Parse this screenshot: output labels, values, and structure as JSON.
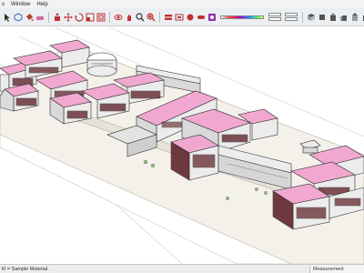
{
  "menu": {
    "items": [
      {
        "label": "s",
        "name": "menu-tools"
      },
      {
        "label": "Window",
        "name": "menu-window"
      },
      {
        "label": "Help",
        "name": "menu-help"
      }
    ]
  },
  "toolbar": {
    "groups_left": [
      {
        "name": "select-icon",
        "color": "#333333"
      },
      {
        "name": "component-icon",
        "color": "#3a66b8"
      },
      {
        "name": "paint-bucket-icon",
        "color": "#b04030"
      },
      {
        "name": "eraser-icon",
        "color": "#d26aa0"
      },
      {
        "name": "sep"
      },
      {
        "name": "pushpull-icon",
        "color": "#c03030"
      },
      {
        "name": "move-icon",
        "color": "#c03030"
      },
      {
        "name": "rotate-icon",
        "color": "#c03030"
      },
      {
        "name": "scale-icon",
        "color": "#c03030"
      },
      {
        "name": "offset-icon",
        "color": "#c03030"
      },
      {
        "name": "sep"
      },
      {
        "name": "orbit-icon",
        "color": "#c03030"
      },
      {
        "name": "pan-icon",
        "color": "#c03030"
      },
      {
        "name": "zoom-icon",
        "color": "#333333"
      },
      {
        "name": "zoom-extents-icon",
        "color": "#c03030"
      },
      {
        "name": "sep"
      },
      {
        "name": "section-icon",
        "color": "#c03030"
      },
      {
        "name": "xray-icon",
        "color": "#c03030"
      },
      {
        "name": "shadow-icon",
        "color": "#c03030"
      },
      {
        "name": "fog-icon",
        "color": "#c03030"
      },
      {
        "name": "style-icon",
        "color": "#9030a0"
      }
    ],
    "groups_right": [
      {
        "name": "iso-view-icon",
        "color": "#555555"
      },
      {
        "name": "top-view-icon",
        "color": "#555555"
      },
      {
        "name": "front-view-icon",
        "color": "#555555"
      },
      {
        "name": "right-view-icon",
        "color": "#555555"
      },
      {
        "name": "back-view-icon",
        "color": "#555555"
      },
      {
        "name": "left-view-icon",
        "color": "#555555"
      },
      {
        "name": "sep"
      },
      {
        "name": "xray-style-icon",
        "color": "#555555"
      },
      {
        "name": "wireframe-icon",
        "color": "#555555"
      },
      {
        "name": "hidden-line-icon",
        "color": "#555555"
      },
      {
        "name": "shaded-icon",
        "color": "#555555"
      },
      {
        "name": "textured-icon",
        "color": "#555555"
      },
      {
        "name": "monochrome-icon",
        "color": "#555555"
      },
      {
        "name": "sep"
      },
      {
        "name": "layer-icon",
        "color": "#555555"
      },
      {
        "name": "outliner-icon",
        "color": "#555555"
      }
    ]
  },
  "status": {
    "text": "i0 = Sample Material.",
    "measurements_label": "Measurement"
  },
  "scene": {
    "roof_color": "#f0a8d0",
    "wall_color": "#ececec",
    "ground_color": "#f4f1ea",
    "window_color": "#5a1a22",
    "edge_color": "#2a2a2a"
  }
}
